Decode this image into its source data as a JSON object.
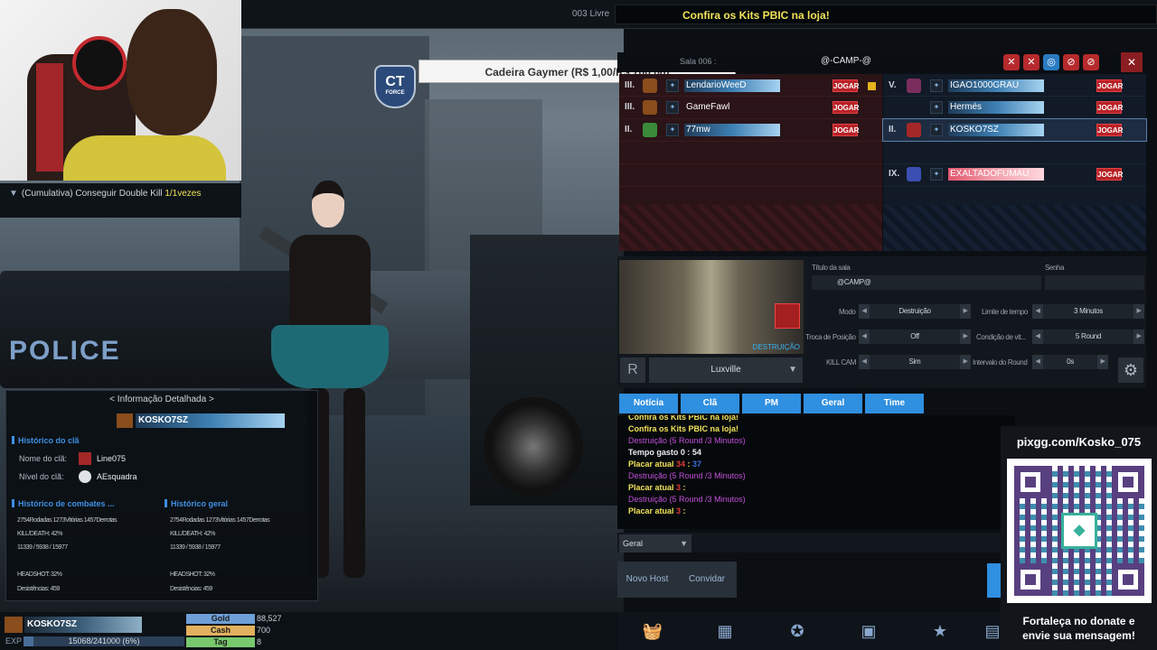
{
  "topbar": {
    "room_status": "003 Livre",
    "notice": "Confira os Kits PBIC na loja!"
  },
  "mission": {
    "text": "(Cumulativa) Conseguir Double Kill ",
    "count": "1/1vezes"
  },
  "ct_badge": {
    "text": "CT",
    "sub": "FORCE"
  },
  "prize_banner": "Cadeira Gaymer (R$ 1,00/R$ 700,00)",
  "room": {
    "title": "Sala 006 :",
    "name": "@-CAMP-@"
  },
  "red_team": [
    {
      "rank": "III.",
      "name": "LendarioWeeD",
      "button": "JOGAR",
      "ready": true
    },
    {
      "rank": "III.",
      "name": "GameFawl",
      "button": "JOGAR",
      "ready": false
    },
    {
      "rank": "II.",
      "name": "77mw",
      "button": "JOGAR",
      "ready": false
    }
  ],
  "blue_team": [
    {
      "rank": "V.",
      "name": "IGAO1000GRAU",
      "button": "JOGAR"
    },
    {
      "rank": "",
      "name": "Hermés",
      "button": "JOGAR"
    },
    {
      "rank": "II.",
      "name": "KOSKO7SZ",
      "button": "JOGAR"
    },
    {
      "rank": "IX.",
      "name": "EXALTADOFUMAU",
      "button": "JOGAR"
    }
  ],
  "settings": {
    "map": "Luxville",
    "map_mode_label": "DESTRUIÇÃO",
    "room_title_label": "Título da sala",
    "room_title_value": "@CAMP@",
    "password_label": "Senha",
    "mode_label": "Modo",
    "mode_value": "Destruição",
    "time_limit_label": "Limite de tempo",
    "time_limit_value": "3 Minutos",
    "swap_label": "Troca de Posição",
    "swap_value": "Off",
    "win_cond_label": "Condição de vit...",
    "win_cond_value": "5 Round",
    "killcam_label": "KILL CAM",
    "killcam_value": "Sim",
    "round_interval_label": "Intervalo do Round",
    "round_interval_value": "0s",
    "r_label": "R"
  },
  "chat_tabs": [
    "Notícia",
    "Clã",
    "PM",
    "Geral",
    "Time"
  ],
  "chat": {
    "line0": "Confira os Kits PBIC na loja!",
    "line1": "Confira os Kits PBIC na loja!",
    "line2a": "Destruição",
    "line2b": " (5 Round /3 Minutos)",
    "line3": "Tempo gasto 0 : 54",
    "line4a": "Placar atual ",
    "line4b": "34",
    "line4c": " : ",
    "line4d": "37",
    "line5a": "Destruição",
    "line5b": " (5 Round /3 Minutos)",
    "line6a": "Placar atual ",
    "line6b": "3",
    "line6c": " : ",
    "line7a": "Destruição",
    "line7b": " (5 Round /3 Minutos)",
    "line8a": "Placar atual ",
    "line8b": "3",
    "line8c": " : "
  },
  "chat_channel": "Geral",
  "room_buttons": {
    "new_host": "Novo Host",
    "invite": "Convidar"
  },
  "detail": {
    "header": "< Informação Detalhada >",
    "player_name": "KOSKO7SZ",
    "clan_history": "Histórico do clã",
    "clan_name_label": "Nome do clã:",
    "clan_name": "Line075",
    "clan_level_label": "Nível do clã:",
    "clan_level": "AEsquadra",
    "combat_history": "Histórico de combates ...",
    "general_history": "Histórico geral",
    "stats_line1": "2754Rodadas 1273Vitórias 1457Derrotas",
    "stats_kd": "KILL/DEATH: 42%",
    "stats_kills": "11339 / 5938 / 15977",
    "stats_headshot": "HEADSHOT: 32%",
    "stats_desist": "Desistências: 459"
  },
  "player_bar": {
    "name": "KOSKO7SZ",
    "exp_label": "EXP",
    "exp_text": "15068/241000 (6%)",
    "exp_fraction": 0.06,
    "gold_label": "Gold",
    "gold": "88,527",
    "cash_label": "Cash",
    "cash": "700",
    "tag_label": "Tag",
    "tag": "8"
  },
  "donation": {
    "link": "pixgg.com/Kosko_075",
    "message_line1": "Fortaleça no donate e",
    "message_line2": "envie sua mensagem!"
  },
  "colors": {
    "accent_blue": "#2f8fe0",
    "jogar_red": "#b82227",
    "notice_yellow": "#f0e25a"
  }
}
